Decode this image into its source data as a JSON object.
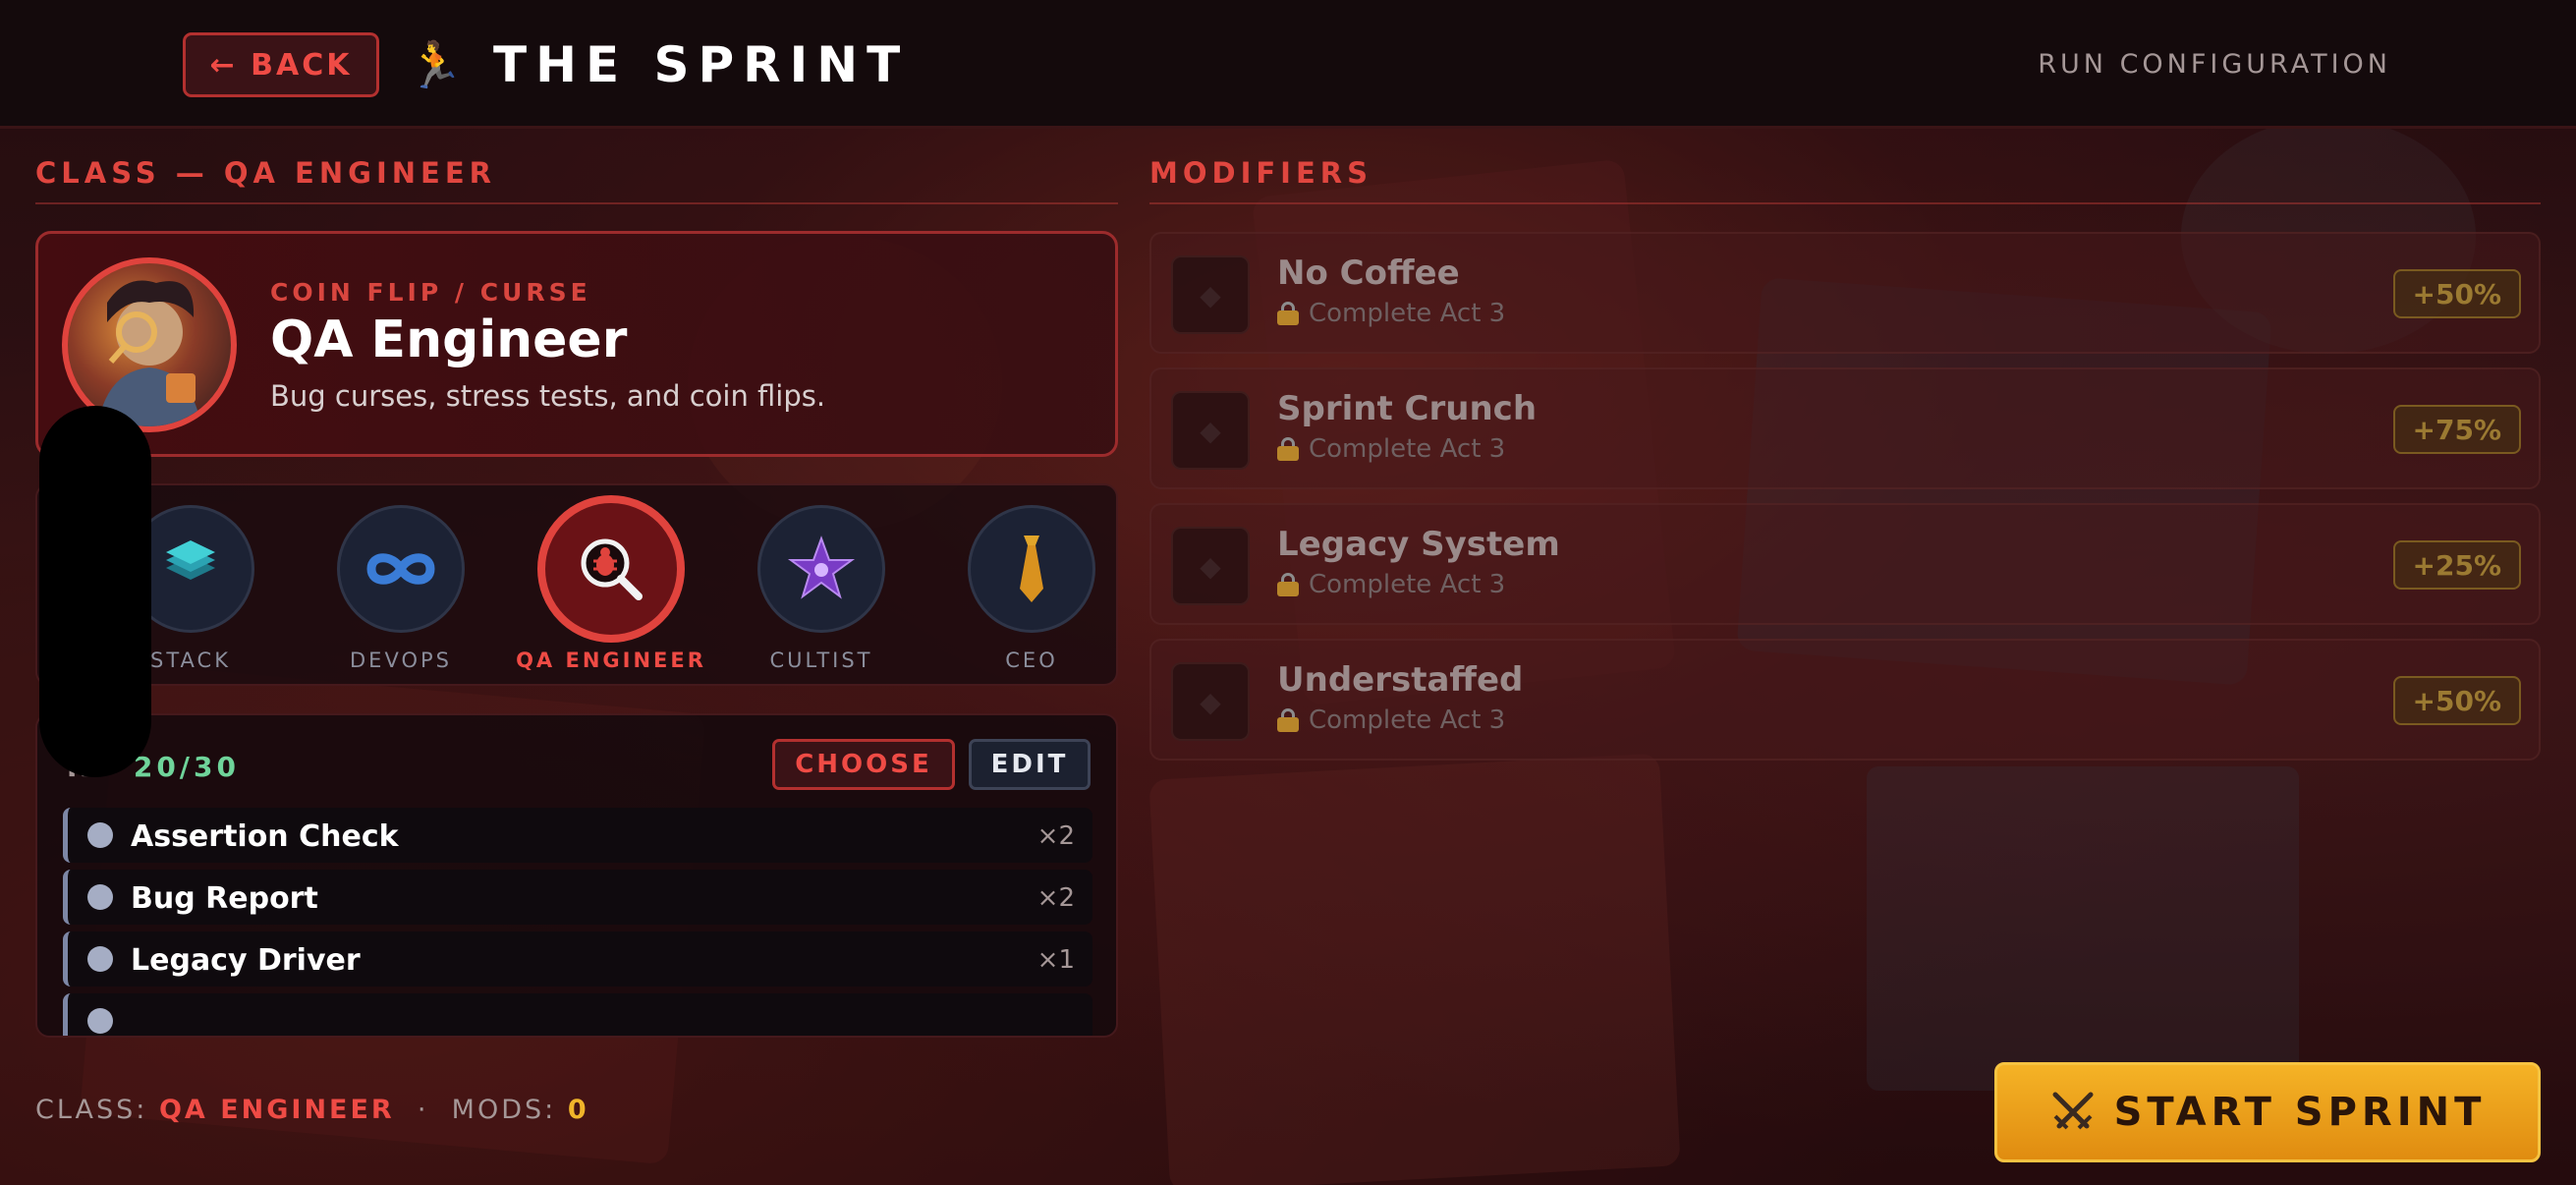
{
  "header": {
    "back_label": "← BACK",
    "title": "THE SPRINT",
    "right_label": "RUN CONFIGURATION"
  },
  "class_section": {
    "heading": "CLASS — QA ENGINEER",
    "card": {
      "subtitle": "COIN FLIP / CURSE",
      "name": "QA Engineer",
      "description": "Bug curses, stress tests, and coin flips."
    },
    "options": [
      {
        "label": "STACK",
        "icon": "stack-icon"
      },
      {
        "label": "DEVOPS",
        "icon": "infinity-icon"
      },
      {
        "label": "QA ENGINEER",
        "icon": "bug-magnifier-icon",
        "selected": true
      },
      {
        "label": "CULTIST",
        "icon": "pentagram-icon"
      },
      {
        "label": "CEO",
        "icon": "tie-icon"
      }
    ]
  },
  "deck": {
    "label_fragment": "K ·",
    "count": "20/30",
    "choose_label": "CHOOSE",
    "edit_label": "EDIT",
    "cards": [
      {
        "name": "Assertion Check",
        "qty": "×2"
      },
      {
        "name": "Bug Report",
        "qty": "×2"
      },
      {
        "name": "Legacy Driver",
        "qty": "×1"
      }
    ]
  },
  "modifiers": {
    "heading": "MODIFIERS",
    "items": [
      {
        "name": "No Coffee",
        "lock": "Complete Act 3",
        "pct": "+50%"
      },
      {
        "name": "Sprint Crunch",
        "lock": "Complete Act 3",
        "pct": "+75%"
      },
      {
        "name": "Legacy System",
        "lock": "Complete Act 3",
        "pct": "+25%"
      },
      {
        "name": "Understaffed",
        "lock": "Complete Act 3",
        "pct": "+50%"
      }
    ]
  },
  "footer": {
    "class_prefix": "CLASS:",
    "class_value": "QA ENGINEER",
    "separator": "·",
    "mods_prefix": "MODS:",
    "mods_value": "0",
    "start_label": "START SPRINT"
  },
  "colors": {
    "accent_red": "#e0433d",
    "gold": "#f0b52a",
    "green": "#6fd49a"
  }
}
